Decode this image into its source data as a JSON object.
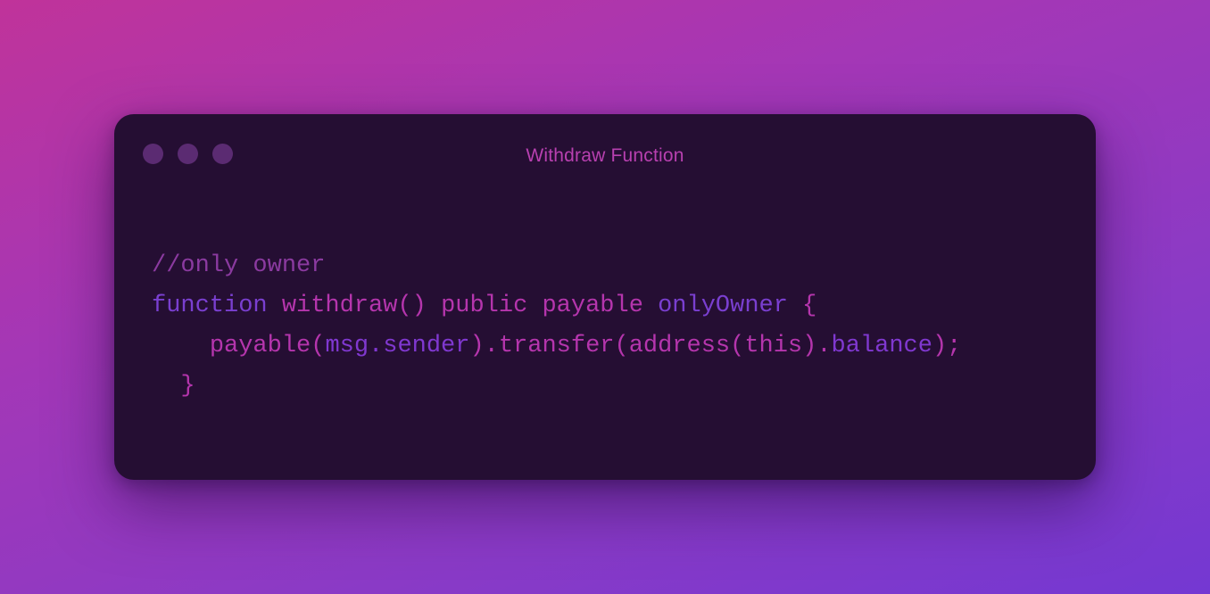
{
  "window": {
    "title": "Withdraw Function",
    "controls": [
      "window-dot",
      "window-dot",
      "window-dot"
    ]
  },
  "code": {
    "line1": {
      "comment": "//only owner"
    },
    "line2": {
      "kw": "function",
      "name": "withdraw()",
      "vis": "public",
      "mod1": "payable",
      "mod2": "onlyOwner",
      "brace": "{"
    },
    "line3": {
      "call1": "payable(",
      "obj": "msg.sender",
      "call2": ").transfer(",
      "call3": "address(",
      "arg": "this",
      "call4": ").",
      "prop": "balance",
      "end": ");"
    },
    "line4": {
      "brace": "}"
    }
  },
  "colors": {
    "background_start": "#c0339a",
    "background_end": "#7438d2",
    "window_bg": "#250e33",
    "dot": "#5b2b72",
    "title": "#b840b0"
  }
}
